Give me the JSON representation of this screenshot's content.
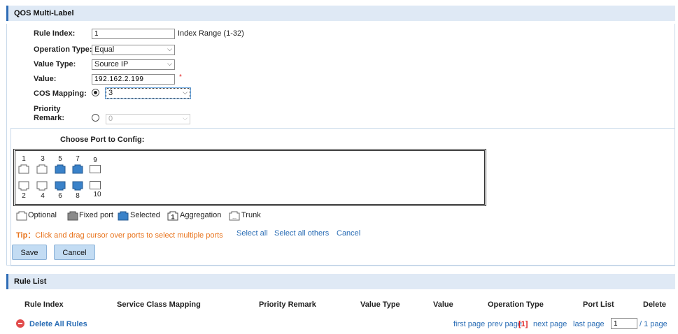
{
  "header": {
    "title": "QOS Multi-Label"
  },
  "form": {
    "rule_index_label": "Rule Index:",
    "rule_index_value": "1",
    "rule_index_hint": "Index Range (1-32)",
    "operation_type_label": "Operation Type:",
    "operation_type_value": "Equal",
    "value_type_label": "Value Type:",
    "value_type_value": "Source IP",
    "value_label": "Value:",
    "value_value": "192.162.2.199",
    "required_mark": "*",
    "cos_mapping_label": "COS Mapping:",
    "cos_mapping_value": "3",
    "cos_mapping_selected": true,
    "priority_remark_label_1": "Priority",
    "priority_remark_label_2": "Remark:",
    "priority_remark_value": "0",
    "priority_remark_selected": false
  },
  "ports": {
    "title": "Choose Port to Config:",
    "top_row": [
      {
        "num": "1",
        "state": "optional"
      },
      {
        "num": "3",
        "state": "optional"
      },
      {
        "num": "5",
        "state": "selected"
      },
      {
        "num": "7",
        "state": "selected"
      },
      {
        "num": "9",
        "state": "sfp"
      }
    ],
    "bottom_row": [
      {
        "num": "2",
        "state": "optional"
      },
      {
        "num": "4",
        "state": "optional"
      },
      {
        "num": "6",
        "state": "selected"
      },
      {
        "num": "8",
        "state": "selected"
      },
      {
        "num": "10",
        "state": "sfp"
      }
    ],
    "legend": {
      "optional": "Optional",
      "fixed": "Fixed port",
      "selected": "Selected",
      "aggregation": "Aggregation",
      "aggregation_num": "1",
      "trunk": "Trunk",
      "trunk_glyph": "..."
    },
    "tip_label": "Tip：",
    "tip_text": "Click and drag cursor over ports to select multiple ports",
    "select_all": "Select all",
    "select_all_others": "Select all others",
    "cancel_link": "Cancel"
  },
  "buttons": {
    "save": "Save",
    "cancel": "Cancel"
  },
  "rule_list": {
    "title": "Rule List",
    "columns": [
      "Rule Index",
      "Service Class Mapping",
      "Priority Remark",
      "Value Type",
      "Value",
      "Operation Type",
      "Port List",
      "Delete"
    ],
    "delete_all": "Delete All Rules",
    "pager": {
      "first": "first page",
      "prev": "prev page",
      "current": "[1]",
      "next": "next page",
      "last": "last page",
      "input_value": "1",
      "total": "/ 1 page"
    }
  },
  "colors": {
    "header_bg": "#dfe9f5",
    "header_accent": "#2d6bb5",
    "port_selected": "#3a82c9",
    "tip": "#e8731c",
    "link": "#2a6db5",
    "button_bg": "#c3dcf3"
  }
}
